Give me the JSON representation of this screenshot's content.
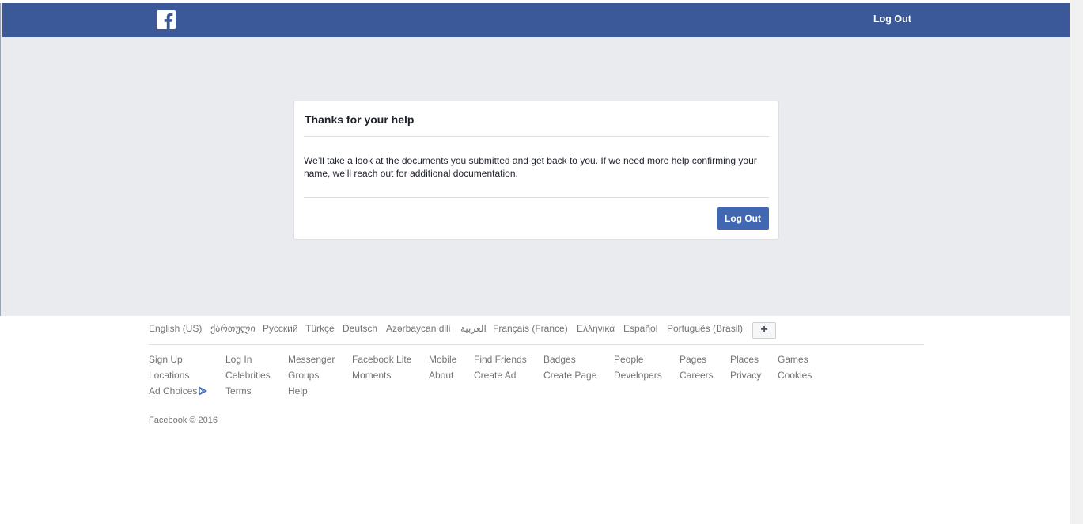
{
  "header": {
    "logo_icon": "facebook-f-icon",
    "logout_label": "Log Out",
    "bar_color": "#3b5998"
  },
  "card": {
    "title": "Thanks for your help",
    "body": "We’ll take a look at the documents you submitted and get back to you. If we need more help confirming your name, we’ll reach out for additional documentation.",
    "logout_label": "Log Out",
    "button_color": "#4267b2"
  },
  "footer": {
    "languages": [
      "English (US)",
      "ქართული",
      "Русский",
      "Türkçe",
      "Deutsch",
      "Azərbaycan dili",
      "العربية",
      "Français (France)",
      "Ελληνικά",
      "Español",
      "Português (Brasil)"
    ],
    "more_languages_label": "+",
    "links": [
      [
        "Sign Up",
        "Log In",
        "Messenger",
        "Facebook Lite",
        "Mobile",
        "Find Friends",
        "Badges",
        "People",
        "Pages",
        "Places",
        "Games"
      ],
      [
        "Locations",
        "Celebrities",
        "Groups",
        "Moments",
        "About",
        "Create Ad",
        "Create Page",
        "Developers",
        "Careers",
        "Privacy",
        "Cookies"
      ],
      [
        "Ad Choices",
        "Terms",
        "Help"
      ]
    ],
    "adchoices_icon": "adchoices-icon",
    "copyright": "Facebook © 2016"
  }
}
